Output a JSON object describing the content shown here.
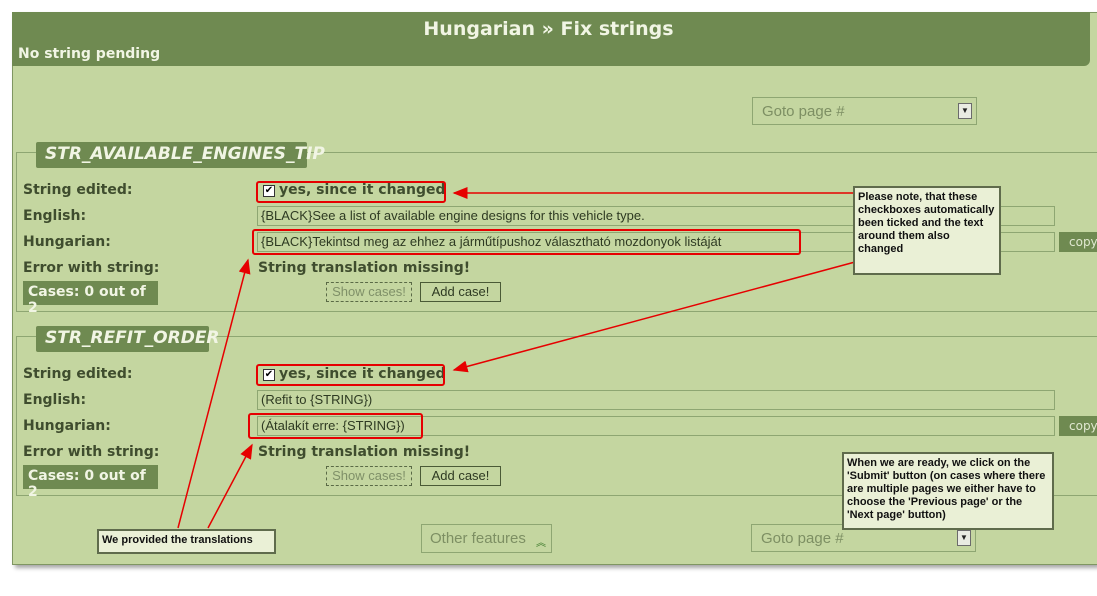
{
  "header": {
    "title": "Hungarian » Fix strings",
    "status": "No string pending"
  },
  "goto_top": {
    "placeholder": "Goto page #"
  },
  "goto_bottom": {
    "placeholder": "Goto page #"
  },
  "labels": {
    "string_edited": "String edited:",
    "english": "English:",
    "hungarian": "Hungarian:",
    "error": "Error with string:"
  },
  "strings": [
    {
      "id": "STR_AVAILABLE_ENGINES_TIP",
      "edited_text": "yes, since it changed",
      "english": "{BLACK}See a list of available engine designs for this vehicle type.",
      "hungarian": "{BLACK}Tekintsd meg az ehhez a járműtípushoz választható mozdonyok listáját",
      "copy_label": "copy",
      "error": "String translation missing!",
      "cases": "Cases: 0 out of 2",
      "show_cases": "Show cases!",
      "add_case": "Add case!"
    },
    {
      "id": "STR_REFIT_ORDER",
      "edited_text": "yes, since it changed",
      "english": "(Refit to {STRING})",
      "hungarian": "(Átalakít erre: {STRING})",
      "copy_label": "copy",
      "error": "String translation missing!",
      "cases": "Cases: 0 out of 2",
      "show_cases": "Show cases!",
      "add_case": "Add case!"
    }
  ],
  "other_features": "Other features",
  "notes": {
    "checkboxes": "Please note, that these checkboxes automatically been ticked and the text around them also changed",
    "provided": "We provided the translations",
    "submit": "When we are ready, we click on the 'Submit' button (on cases where there are multiple pages we either have to choose the 'Previous page' or the 'Next page' button)"
  },
  "colors": {
    "background": "#c4d6a0",
    "header": "#6f8a51",
    "annotation": "#e60000"
  }
}
